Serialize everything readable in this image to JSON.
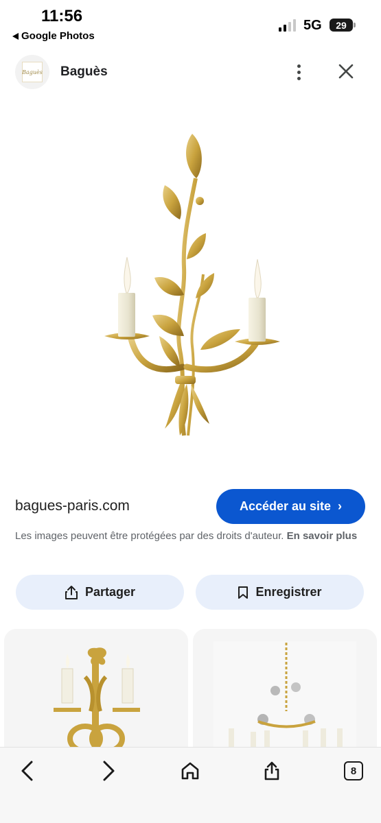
{
  "status": {
    "time": "11:56",
    "back_label": "Google Photos",
    "network": "5G",
    "battery": "29"
  },
  "header": {
    "title": "Baguès",
    "logo_text": "Baguès"
  },
  "result": {
    "domain": "bagues-paris.com",
    "visit_label": "Accéder au site",
    "notice_text": "Les images peuvent être protégées par des droits d'auteur.",
    "learn_more": "En savoir plus"
  },
  "actions": {
    "share_label": "Partager",
    "save_label": "Enregistrer"
  },
  "toolbar": {
    "tabs_count": "8"
  },
  "icons": {
    "back": "chevron-left-icon",
    "forward": "chevron-right-icon",
    "home": "home-icon",
    "share": "share-icon",
    "tabs": "tabs-icon",
    "more": "more-vertical-icon",
    "close": "close-icon",
    "bookmark": "bookmark-icon"
  },
  "colors": {
    "accent": "#0b57d0",
    "tonal_button": "#e8effb",
    "gold": "#c9a33e"
  }
}
